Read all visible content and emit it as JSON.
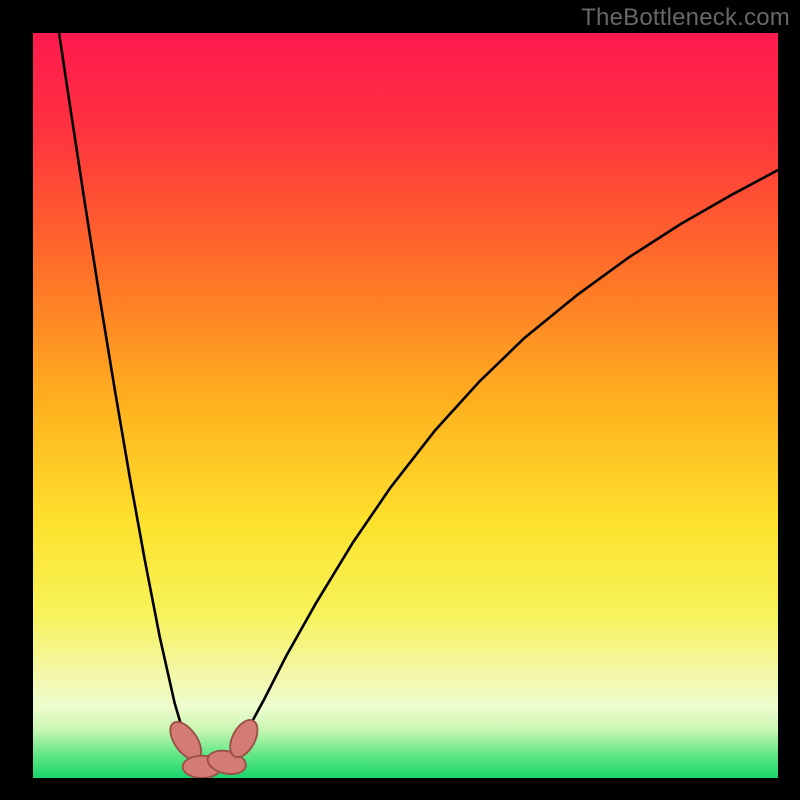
{
  "watermark": "TheBottleneck.com",
  "colors": {
    "frame": "#000000",
    "watermark": "#676767",
    "curve": "#000000",
    "marker_fill": "#d47c73",
    "marker_stroke": "#9a4f47",
    "gradient_stops": [
      {
        "offset": 0.0,
        "color": "#ff1a4f"
      },
      {
        "offset": 0.12,
        "color": "#ff2f40"
      },
      {
        "offset": 0.3,
        "color": "#ff6a2a"
      },
      {
        "offset": 0.5,
        "color": "#ffb21e"
      },
      {
        "offset": 0.66,
        "color": "#fde22e"
      },
      {
        "offset": 0.78,
        "color": "#f7f35a"
      },
      {
        "offset": 0.86,
        "color": "#f4f7a8"
      },
      {
        "offset": 0.905,
        "color": "#eefccf"
      },
      {
        "offset": 0.935,
        "color": "#c9f6b2"
      },
      {
        "offset": 0.965,
        "color": "#6be98a"
      },
      {
        "offset": 1.0,
        "color": "#17d56a"
      }
    ]
  },
  "chart_data": {
    "type": "line",
    "title": "",
    "xlabel": "",
    "ylabel": "",
    "xlim": [
      0,
      100
    ],
    "ylim": [
      0,
      100
    ],
    "series": [
      {
        "name": "curve",
        "x": [
          3.5,
          5,
          7,
          9,
          11,
          13,
          15,
          17,
          19,
          20.5,
          22,
          23.5,
          25.5,
          28,
          31,
          34,
          38,
          43,
          48,
          54,
          60,
          66,
          73,
          80,
          87,
          94,
          100
        ],
        "y": [
          100,
          90.0,
          76.9,
          64.2,
          52.0,
          40.3,
          29.3,
          19.0,
          10.1,
          5.0,
          2.0,
          1.5,
          2.0,
          5.0,
          10.5,
          16.4,
          23.5,
          31.7,
          39.0,
          46.7,
          53.3,
          59.1,
          64.8,
          69.9,
          74.4,
          78.4,
          81.6
        ]
      }
    ],
    "markers": [
      {
        "x": 20.5,
        "y": 5.0,
        "rx": 1.5,
        "ry": 2.9,
        "angle": -35
      },
      {
        "x": 22.7,
        "y": 1.5,
        "rx": 2.6,
        "ry": 1.5,
        "angle": 0
      },
      {
        "x": 26.0,
        "y": 2.1,
        "rx": 2.6,
        "ry": 1.5,
        "angle": 12
      },
      {
        "x": 28.3,
        "y": 5.3,
        "rx": 1.5,
        "ry": 2.7,
        "angle": 28
      }
    ]
  }
}
